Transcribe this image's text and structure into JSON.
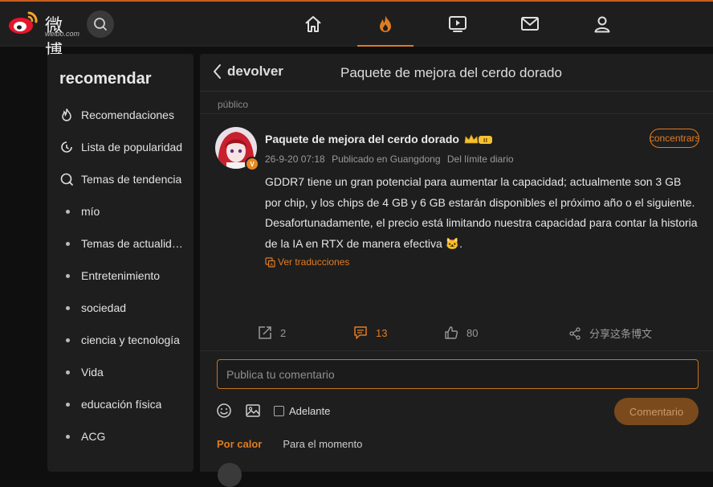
{
  "brand": {
    "logo_text": "微博",
    "logo_sub": "weibo.com"
  },
  "topnav": {
    "items": [
      {
        "name": "home-icon"
      },
      {
        "name": "hot-icon"
      },
      {
        "name": "video-icon"
      },
      {
        "name": "mail-icon"
      },
      {
        "name": "user-icon"
      }
    ],
    "active": "hot",
    "accent": "#e07c22"
  },
  "sidebar": {
    "title": "recomendar",
    "items": [
      {
        "label": "Recomendaciones",
        "icon": "flame-icon"
      },
      {
        "label": "Lista de popularidad",
        "icon": "clock-icon"
      },
      {
        "label": "Temas de tendencia",
        "icon": "topic-icon"
      },
      {
        "label": "mío",
        "icon": "dot"
      },
      {
        "label": "Temas de actualidad",
        "icon": "dot"
      },
      {
        "label": "Entretenimiento",
        "icon": "dot"
      },
      {
        "label": "sociedad",
        "icon": "dot"
      },
      {
        "label": "ciencia y tecnología",
        "icon": "dot"
      },
      {
        "label": "Vida",
        "icon": "dot"
      },
      {
        "label": "educación física",
        "icon": "dot"
      },
      {
        "label": "ACG",
        "icon": "dot"
      }
    ]
  },
  "header": {
    "back_label": "devolver",
    "title": "Paquete de mejora del cerdo dorado"
  },
  "post": {
    "visibility": "público",
    "author": "Paquete de mejora del cerdo dorado",
    "follow_label": "+concentrarse",
    "date": "26-9-20 07:18",
    "location": "Publicado en Guangdong",
    "source": "Del límite diario",
    "text": "GDDR7 tiene un gran potencial para aumentar la capacidad; actualmente son 3 GB por chip, y los chips de 4 GB y 6 GB estarán disponibles el próximo año o el siguiente. Desafortunadamente, el precio está limitando nuestra capacidad para contar la historia de la IA en RTX de manera efectiva",
    "emoji": "🐱",
    "text_end": ".",
    "translate_label": "Ver traducciones",
    "reposts": "2",
    "comments": "13",
    "likes": "80",
    "share_label": "分享这条博文"
  },
  "composer": {
    "placeholder": "Publica tu comentario",
    "forward_label": "Adelante",
    "submit_label": "Comentario"
  },
  "sort": {
    "hot": "Por calor",
    "recent": "Para el momento"
  }
}
